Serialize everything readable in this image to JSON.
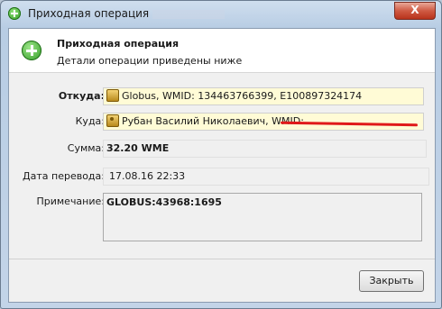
{
  "window": {
    "title": "Приходная операция",
    "close_label": "X"
  },
  "header": {
    "title": "Приходная операция",
    "subtitle": "Детали операции приведены ниже"
  },
  "fields": {
    "from_label": "Откуда:",
    "from_value": "Globus, WMID: 134463766399, E100897324174",
    "to_label": "Куда:",
    "to_value": "Рубан Василий Николаевич, WMID:",
    "amount_label": "Сумма:",
    "amount_value": "32.20 WME",
    "date_label": "Дата перевода:",
    "date_value": "17.08.16 22:33",
    "note_label": "Примечание:",
    "note_value": "GLOBUS:43968:1695"
  },
  "footer": {
    "close_button_label": "Закрыть"
  },
  "colors": {
    "highlight_field": "#fffbd6",
    "redaction": "#e0191a",
    "close_button": "#cf5a43"
  }
}
